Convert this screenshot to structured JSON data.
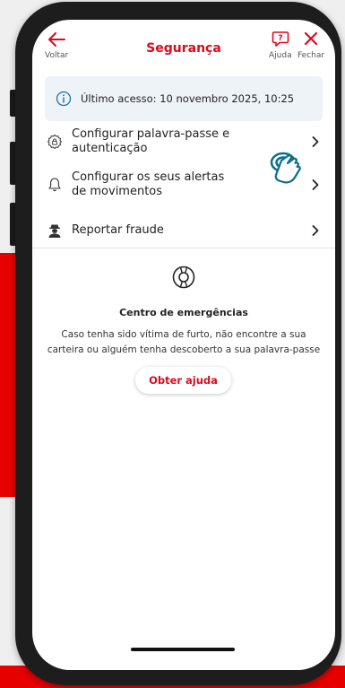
{
  "header": {
    "back_label": "Voltar",
    "title": "Segurança",
    "help_label": "Ajuda",
    "close_label": "Fechar"
  },
  "info_banner": {
    "text": "Último acesso: 10 novembro 2025, 10:25"
  },
  "menu_items": [
    {
      "label": "Configurar palavra-passe e autenticação",
      "icon": "settings-lock-icon"
    },
    {
      "label_line1": "Configurar os seus alertas",
      "label_line2": "de movimentos",
      "icon": "bell-icon"
    },
    {
      "label": "Reportar fraude",
      "icon": "fraudster-icon"
    }
  ],
  "emergency": {
    "title": "Centro de emergências",
    "line1": "Caso tenha sido vítima de furto, não encontre a sua",
    "line2": "carteira ou alguém tenha descoberto a sua palavra-passe",
    "button_label": "Obter ajuda"
  },
  "colors": {
    "brand_red": "#d80c1d",
    "info_background": "#eef3f8",
    "pointer_blue": "#0b6e8a"
  }
}
